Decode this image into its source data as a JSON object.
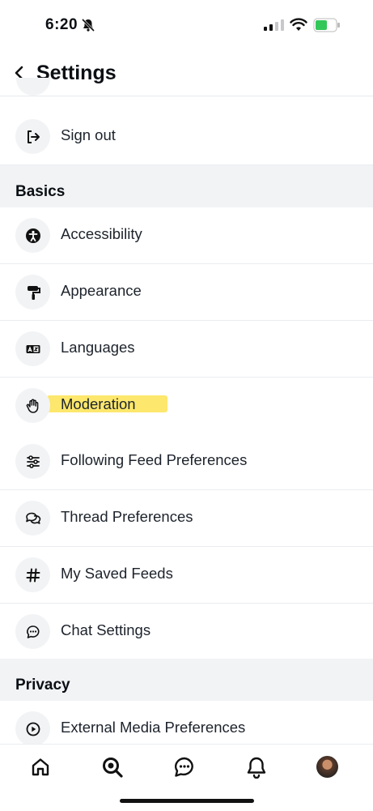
{
  "status_bar": {
    "time": "6:20"
  },
  "header": {
    "title": "Settings"
  },
  "rows": {
    "sign_out": "Sign out",
    "accessibility": "Accessibility",
    "appearance": "Appearance",
    "languages": "Languages",
    "moderation": "Moderation",
    "following_feed": "Following Feed Preferences",
    "thread_prefs": "Thread Preferences",
    "saved_feeds": "My Saved Feeds",
    "chat_settings": "Chat Settings",
    "external_media": "External Media Preferences"
  },
  "sections": {
    "basics": "Basics",
    "privacy": "Privacy"
  },
  "highlight": {
    "target": "moderation",
    "color": "#fde45c"
  },
  "tabbar": {
    "items": [
      "home-icon",
      "search-icon",
      "chat-icon",
      "bell-icon",
      "profile-avatar"
    ]
  }
}
